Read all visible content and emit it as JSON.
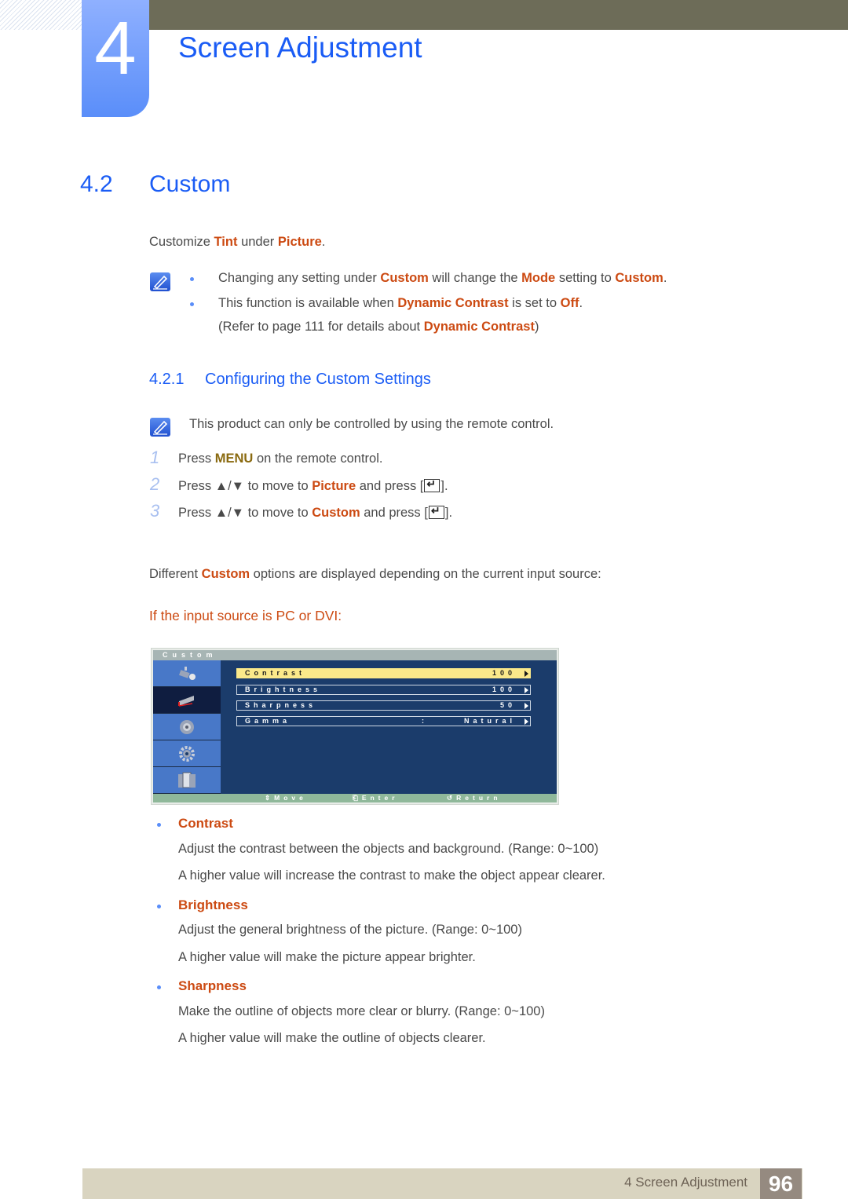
{
  "header": {
    "chapter_number": "4",
    "chapter_title": "Screen Adjustment"
  },
  "section": {
    "number": "4.2",
    "title": "Custom",
    "intro": {
      "pre": "Customize ",
      "h1": "Tint",
      "mid": " under ",
      "h2": "Picture",
      "post": "."
    },
    "notes": [
      {
        "pre": "Changing any setting under ",
        "h1": "Custom",
        "mid": " will change the ",
        "h2": "Mode",
        "mid2": " setting to ",
        "h3": "Custom",
        "post": "."
      },
      {
        "pre": "This function is available when ",
        "h1": "Dynamic Contrast",
        "mid": " is set to ",
        "h2": "Off",
        "post": "."
      },
      {
        "pre": "(Refer to page 111 for details about ",
        "h1": "Dynamic Contrast",
        "post": ")"
      }
    ]
  },
  "subsection": {
    "number": "4.2.1",
    "title": "Configuring the Custom Settings",
    "note": "This product can only be controlled by using the remote control.",
    "steps": [
      {
        "num": "1",
        "pre": "Press ",
        "h": "MENU",
        "post": " on the remote control."
      },
      {
        "num": "2",
        "pre": "Press ▲/▼ to move to ",
        "h": "Picture",
        "post": " and press [",
        "end": "]."
      },
      {
        "num": "3",
        "pre": "Press ▲/▼ to move to ",
        "h": "Custom",
        "post": " and press [",
        "end": "]."
      }
    ],
    "different": {
      "pre": "Different ",
      "h": "Custom",
      "post": " options are displayed depending on the current input source:"
    },
    "source_heading": "If the input source is PC or DVI:"
  },
  "osd": {
    "title": "Custom",
    "rows": [
      {
        "label": "Contrast",
        "value": "100",
        "selected": true
      },
      {
        "label": "Brightness",
        "value": "100",
        "selected": false
      },
      {
        "label": "Sharpness",
        "value": "50",
        "selected": false
      },
      {
        "label": "Gamma",
        "colon": ":",
        "value": "Natural",
        "selected": false
      }
    ],
    "footer": {
      "move": "⇕Move",
      "enter": "Enter",
      "return": "Return"
    }
  },
  "items": [
    {
      "title": "Contrast",
      "lines": [
        "Adjust the contrast between the objects and background. (Range: 0~100)",
        "A higher value will increase the contrast to make the object appear clearer."
      ]
    },
    {
      "title": "Brightness",
      "lines": [
        "Adjust the general brightness of the picture. (Range: 0~100)",
        "A higher value will make the picture appear brighter."
      ]
    },
    {
      "title": "Sharpness",
      "lines": [
        "Make the outline of objects more clear or blurry. (Range: 0~100)",
        "A higher value will make the outline of objects clearer."
      ]
    }
  ],
  "footer": {
    "chapter_label": "4 Screen Adjustment",
    "page": "96"
  },
  "colors": {
    "accent_blue": "#1a5cf5",
    "highlight_orange": "#cc4a12",
    "menu_gold": "#8a6a10",
    "top_bar": "#6d6c58"
  }
}
